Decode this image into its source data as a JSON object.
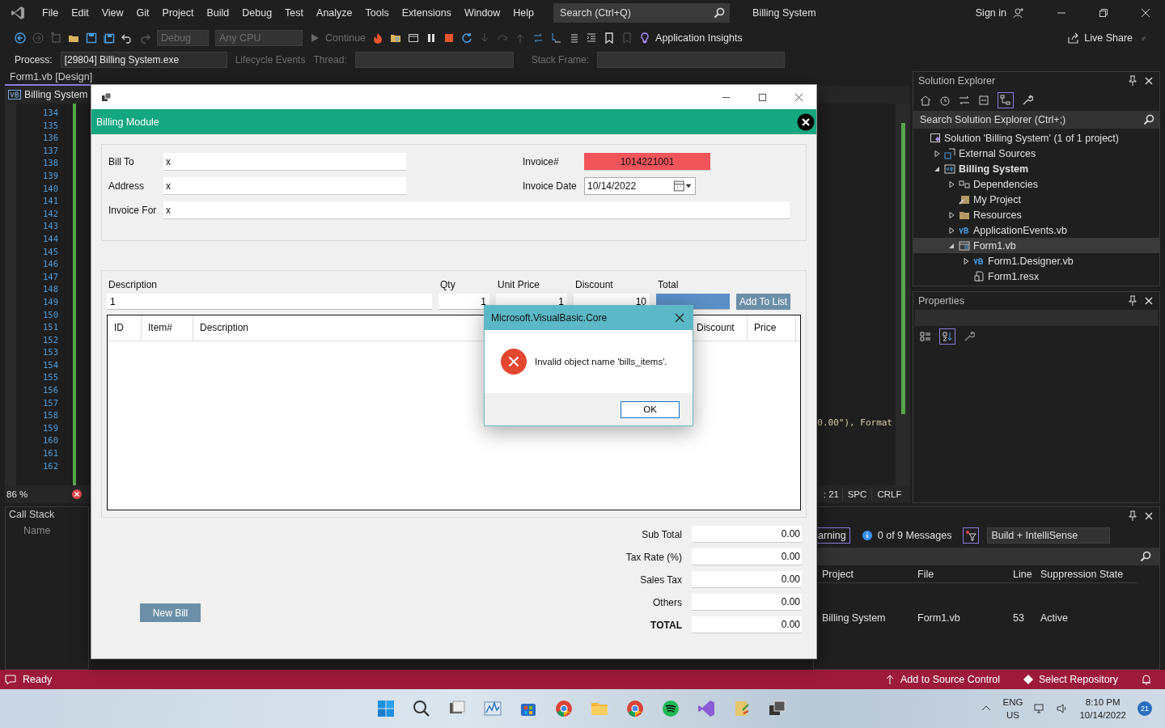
{
  "menu": [
    "File",
    "Edit",
    "View",
    "Git",
    "Project",
    "Build",
    "Debug",
    "Test",
    "Analyze",
    "Tools",
    "Extensions",
    "Window",
    "Help"
  ],
  "search": {
    "placeholder": "Search (Ctrl+Q)"
  },
  "solution_name": "Billing System",
  "sign_in": "Sign in",
  "toolbar": {
    "configuration": "Debug",
    "platform": "Any CPU",
    "continue": "Continue",
    "insights": "Application Insights",
    "live_share": "Live Share"
  },
  "debug_bar": {
    "process_label": "Process:",
    "process": "[29804] Billing System.exe",
    "lifecycle": "Lifecycle Events",
    "thread_label": "Thread:",
    "stack_frame_label": "Stack Frame:"
  },
  "editor": {
    "tab": "Form1.vb [Design]",
    "scope": "Billing System",
    "line_numbers": [
      "134",
      "135",
      "136",
      "137",
      "138",
      "139",
      "140",
      "141",
      "142",
      "143",
      "144",
      "145",
      "146",
      "147",
      "148",
      "149",
      "150",
      "151",
      "152",
      "153",
      "154",
      "155",
      "156",
      "157",
      "158",
      "159",
      "160",
      "161",
      "162"
    ],
    "code_fragment": "0.00\"), Format",
    "zoom": "86 %",
    "status": [
      ": 21",
      "SPC",
      "CRLF"
    ]
  },
  "solution_explorer": {
    "title": "Solution Explorer",
    "search_placeholder": "Search Solution Explorer (Ctrl+;)",
    "tree": [
      {
        "label": "Solution 'Billing System' (1 of 1 project)",
        "kind": "solution",
        "selected": false,
        "children": [
          {
            "label": "External Sources",
            "kind": "external",
            "expanded": false,
            "selected": false
          },
          {
            "label": "Billing System",
            "kind": "project",
            "expanded": true,
            "selected": false,
            "children": [
              {
                "label": "Dependencies",
                "kind": "dependencies",
                "expanded": false,
                "selected": false
              },
              {
                "label": "My Project",
                "kind": "settings",
                "selected": false
              },
              {
                "label": "Resources",
                "kind": "folder",
                "expanded": false,
                "selected": false
              },
              {
                "label": "ApplicationEvents.vb",
                "kind": "vb",
                "expanded": false,
                "selected": false
              },
              {
                "label": "Form1.vb",
                "kind": "form",
                "expanded": true,
                "selected": true,
                "children": [
                  {
                    "label": "Form1.Designer.vb",
                    "kind": "vb",
                    "expanded": false,
                    "selected": false
                  },
                  {
                    "label": "Form1.resx",
                    "kind": "resx",
                    "selected": false
                  }
                ]
              }
            ]
          }
        ]
      }
    ]
  },
  "properties": {
    "title": "Properties"
  },
  "call_stack": {
    "title": "Call Stack",
    "column": "Name"
  },
  "error_list": {
    "warnings_button": "arning",
    "messages": "0 of 9 Messages",
    "scope": "Build + IntelliSense",
    "columns": [
      "Project",
      "File",
      "Line",
      "Suppression State"
    ],
    "rows": [
      [
        "Billing System",
        "Form1.vb",
        "53",
        "Active"
      ]
    ]
  },
  "status_bar": {
    "state": "Ready",
    "source_control": "Add to Source Control",
    "repository": "Select Repository"
  },
  "form": {
    "header": "Billing Module",
    "bill_to": {
      "label": "Bill To",
      "value": "x"
    },
    "address": {
      "label": "Address",
      "value": "x"
    },
    "invoice_for": {
      "label": "Invoice For",
      "value": "x"
    },
    "invoice_no": {
      "label": "Invoice#",
      "value": "1014221001"
    },
    "invoice_date": {
      "label": "Invoice Date",
      "value": "10/14/2022"
    },
    "item_fields": [
      {
        "label": "Description",
        "value": "1"
      },
      {
        "label": "Qty",
        "value": "1"
      },
      {
        "label": "Unit Price",
        "value": "1"
      },
      {
        "label": "Discount",
        "value": "10"
      },
      {
        "label": "Total"
      }
    ],
    "add_button": "Add To List",
    "grid_columns": [
      "ID",
      "Item#",
      "Description",
      "Discount",
      "Price"
    ],
    "totals": [
      {
        "label": "Sub Total",
        "value": "0.00"
      },
      {
        "label": "Tax Rate (%)",
        "value": "0.00"
      },
      {
        "label": "Sales Tax",
        "value": "0.00"
      },
      {
        "label": "Others",
        "value": "0.00"
      },
      {
        "label": "TOTAL",
        "value": "0.00",
        "kind": "grand"
      }
    ],
    "new_bill": "New Bill"
  },
  "dialog": {
    "title": "Microsoft.VisualBasic.Core",
    "message": "Invalid object name 'bills_items'.",
    "button": "OK"
  },
  "taskbar": {
    "apps": [
      {
        "kind": "start"
      },
      {
        "kind": "search"
      },
      {
        "kind": "window"
      },
      {
        "kind": "chart"
      },
      {
        "kind": "store"
      },
      {
        "kind": "browser"
      },
      {
        "kind": "folder"
      },
      {
        "kind": "browser"
      },
      {
        "kind": "music"
      },
      {
        "kind": "studio"
      },
      {
        "kind": "notes"
      },
      {
        "kind": "desktop"
      }
    ],
    "language": "ENG",
    "region": "US",
    "time": "8:10 PM",
    "date": "10/14/2022",
    "badge": "21"
  }
}
